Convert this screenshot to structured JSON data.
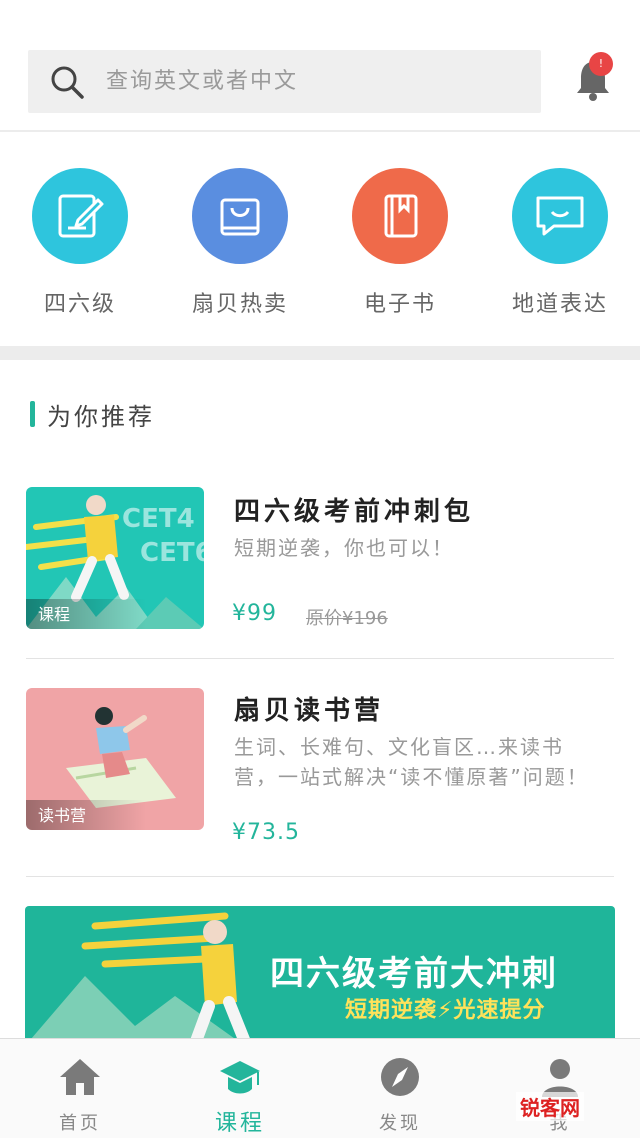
{
  "search": {
    "placeholder": "查询英文或者中文"
  },
  "notifications": {
    "badge": "!"
  },
  "categories": [
    {
      "label": "四六级",
      "color": "#2ec5dd",
      "icon": "pencil-note-icon"
    },
    {
      "label": "扇贝热卖",
      "color": "#5a8ee0",
      "icon": "shopping-bag-icon"
    },
    {
      "label": "电子书",
      "color": "#ef6a4a",
      "icon": "book-icon"
    },
    {
      "label": "地道表达",
      "color": "#2ec5dd",
      "icon": "chat-bubble-icon"
    }
  ],
  "recommend": {
    "title": "为你推荐",
    "items": [
      {
        "title": "四六级考前冲刺包",
        "desc": "短期逆袭，你也可以！",
        "price": "¥99",
        "original_price": "原价¥196",
        "tag": "课程",
        "thumb_text": [
          "CET4",
          "CET6"
        ]
      },
      {
        "title": "扇贝读书营",
        "desc": "生词、长难句、文化盲区…来读书营，一站式解决“读不懂原著”问题！",
        "price": "¥73.5",
        "tag": "读书营"
      }
    ]
  },
  "banner": {
    "title": "四六级考前大冲刺",
    "subtitle": "短期逆袭⚡光速提分"
  },
  "tabs": [
    {
      "label": "首页",
      "icon": "home-icon"
    },
    {
      "label": "课程",
      "icon": "graduation-cap-icon",
      "active": true
    },
    {
      "label": "发现",
      "icon": "compass-icon"
    },
    {
      "label": "我",
      "icon": "user-icon"
    }
  ],
  "watermark": "锐客网",
  "colors": {
    "accent": "#23b59b",
    "badge": "#e84545"
  }
}
